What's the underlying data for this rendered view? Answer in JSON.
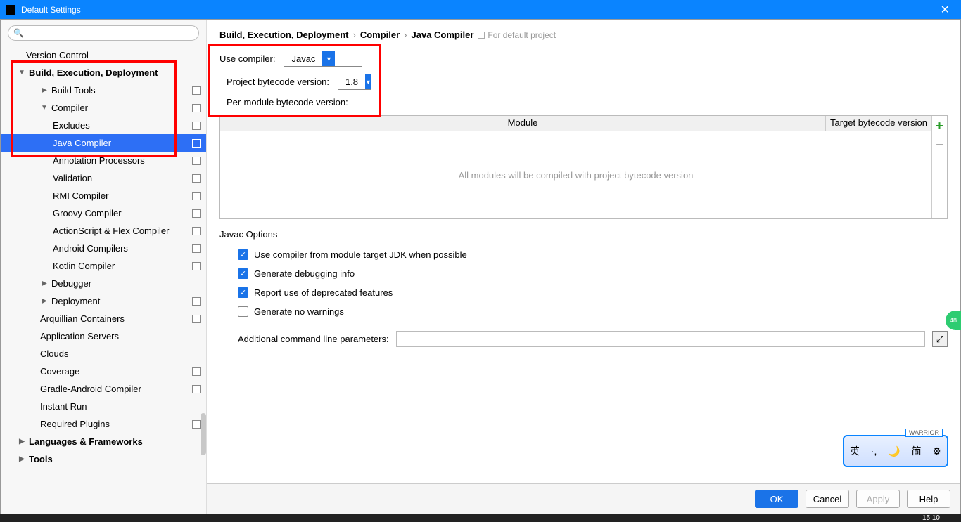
{
  "window": {
    "title": "Default Settings"
  },
  "search": {
    "placeholder": ""
  },
  "tree": {
    "version_control": "Version Control",
    "bed": "Build, Execution, Deployment",
    "build_tools": "Build Tools",
    "compiler": "Compiler",
    "excludes": "Excludes",
    "java_compiler": "Java Compiler",
    "annotation": "Annotation Processors",
    "validation": "Validation",
    "rmi": "RMI Compiler",
    "groovy": "Groovy Compiler",
    "actionscript": "ActionScript & Flex Compiler",
    "android": "Android Compilers",
    "kotlin": "Kotlin Compiler",
    "debugger": "Debugger",
    "deployment": "Deployment",
    "arquillian": "Arquillian Containers",
    "app_servers": "Application Servers",
    "clouds": "Clouds",
    "coverage": "Coverage",
    "gradle_android": "Gradle-Android Compiler",
    "instant_run": "Instant Run",
    "required_plugins": "Required Plugins",
    "lang_fw": "Languages & Frameworks",
    "tools": "Tools"
  },
  "breadcrumb": {
    "p1": "Build, Execution, Deployment",
    "p2": "Compiler",
    "p3": "Java Compiler",
    "hint": "For default project"
  },
  "form": {
    "use_compiler_label": "Use compiler:",
    "use_compiler_value": "Javac",
    "project_bytecode_label": "Project bytecode version:",
    "project_bytecode_value": "1.8",
    "per_module_label": "Per-module bytecode version:"
  },
  "table": {
    "col_module": "Module",
    "col_target": "Target bytecode version",
    "empty": "All modules will be compiled with project bytecode version"
  },
  "javac": {
    "title": "Javac Options",
    "opt1": "Use compiler from module target JDK when possible",
    "opt2": "Generate debugging info",
    "opt3": "Report use of deprecated features",
    "opt4": "Generate no warnings",
    "param_label": "Additional command line parameters:",
    "param_value": ""
  },
  "buttons": {
    "ok": "OK",
    "cancel": "Cancel",
    "apply": "Apply",
    "help": "Help"
  },
  "ime": {
    "tag": "WARRIOR",
    "txt_en": "英",
    "txt_cn": "简"
  },
  "badge": {
    "num": "48"
  },
  "clock": {
    "time": "15:10"
  }
}
